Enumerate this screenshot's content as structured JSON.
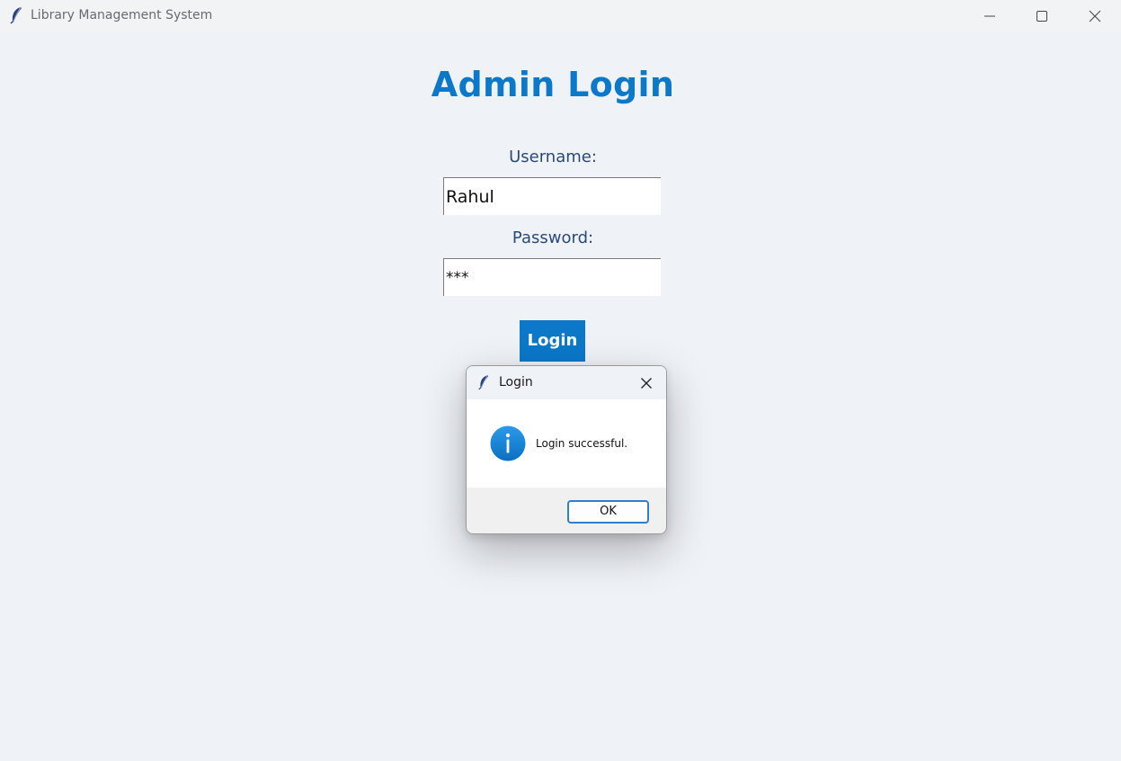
{
  "window": {
    "title": "Library Management System",
    "app_icon": "feather-icon",
    "controls": [
      "minimize-icon",
      "maximize-icon",
      "close-icon"
    ]
  },
  "form": {
    "heading": "Admin Login",
    "username_label": "Username:",
    "username_value": "Rahul",
    "password_label": "Password:",
    "password_value": "***",
    "login_button": "Login"
  },
  "dialog": {
    "title": "Login",
    "icon": "info-icon",
    "message": "Login successful.",
    "ok_button": "OK"
  },
  "colors": {
    "accent": "#0b78c9",
    "label_text": "#2a4a78",
    "background": "#eff2f7"
  }
}
